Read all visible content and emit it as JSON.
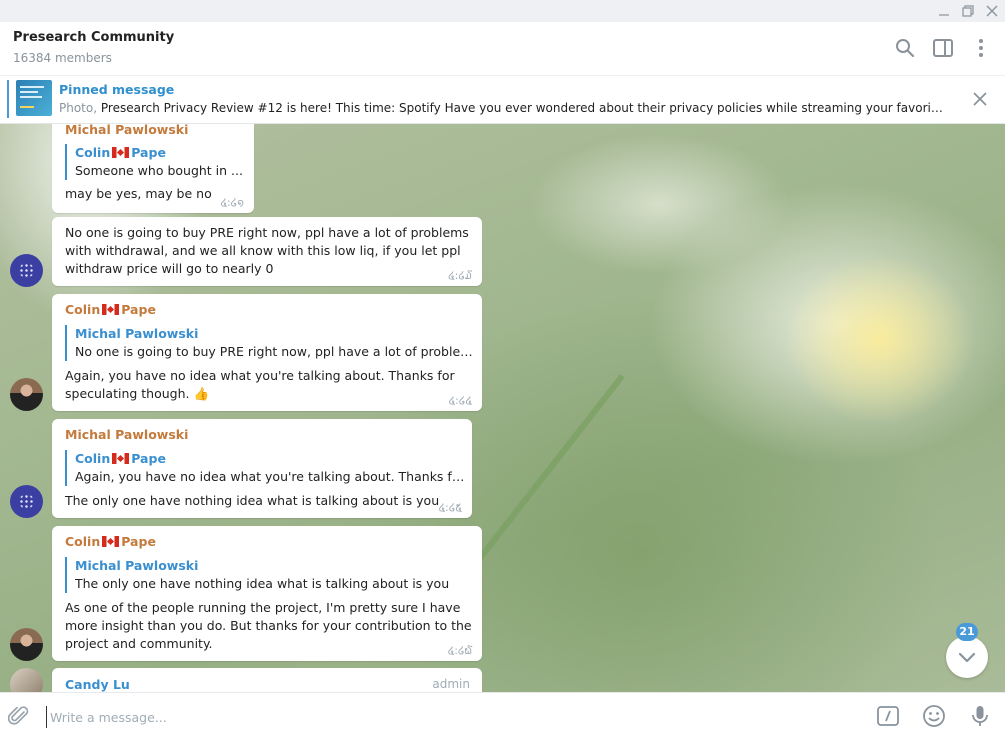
{
  "window": {
    "minimize": "—",
    "restore": "❐",
    "close": "✕"
  },
  "header": {
    "title": "Presearch Community",
    "members": "16384 members"
  },
  "pinned": {
    "label": "Pinned message",
    "kind": "Photo,",
    "text": "Presearch Privacy Review #12 is here! This time: Spotify  Have you ever wondered about their privacy policies while streaming your favorite t..."
  },
  "messages": [
    {
      "sender": "Michal Pawlowski",
      "reply_name": "Colin",
      "reply_name_2": "Pape",
      "reply_text": "Someone who bought in ...",
      "text": "may be yes, may be no",
      "time": "໔:໒໑"
    },
    {
      "text_lines": [
        "No one is going to buy PRE right now, ppl have a lot of problems",
        "with withdrawal, and we all know with this low liq, if you let ppl",
        "withdraw price will go to nearly 0"
      ],
      "time": "໔:໒໓"
    },
    {
      "sender": "Colin",
      "sender_2": "Pape",
      "reply_name": "Michal Pawlowski",
      "reply_text": "No one is going to buy PRE right now, ppl have a lot of problems ...",
      "text_lines": [
        "Again, you have no idea what you're talking about. Thanks for",
        "speculating though. 👍"
      ],
      "time": "໔:໒໔"
    },
    {
      "sender": "Michal Pawlowski",
      "reply_name": "Colin",
      "reply_name_2": "Pape",
      "reply_text": "Again, you have no idea what you're talking about. Thanks for s...",
      "text": "The only one have nothing idea what is talking about is you",
      "time": "໔:໒໕"
    },
    {
      "sender": "Colin",
      "sender_2": "Pape",
      "reply_name": "Michal Pawlowski",
      "reply_text": "The only one have nothing idea what is talking about is you",
      "text_lines": [
        "As one of the people running the project, I'm pretty sure I have",
        "more insight than you do. But thanks for your contribution to the",
        "project and community."
      ],
      "time": "໔:໒໖"
    },
    {
      "sender": "Candy Lu",
      "tag": "admin"
    }
  ],
  "unread_badge": "21",
  "compose": {
    "placeholder": "Write a message..."
  },
  "colors": {
    "accent": "#4a9ad8",
    "sender_orange": "#c47a3c",
    "link_blue": "#3a8fcf"
  }
}
